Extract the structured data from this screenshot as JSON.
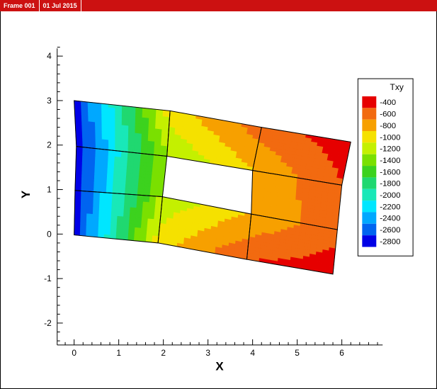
{
  "frame_bar": {
    "frame_label": "Frame 001",
    "date_label": "01 Jul 2015"
  },
  "chart_data": {
    "type": "contour",
    "xlabel": "X",
    "ylabel": "Y",
    "xlim": [
      -0.4,
      6.9
    ],
    "ylim": [
      -2.5,
      4.3
    ],
    "xticks": [
      0,
      1,
      2,
      3,
      4,
      5,
      6
    ],
    "yticks": [
      -2,
      -1,
      0,
      1,
      2,
      3,
      4
    ],
    "legend": {
      "title": "Txy",
      "position": "right",
      "levels": [
        {
          "label": "-400",
          "color": "#e60000"
        },
        {
          "label": "-600",
          "color": "#f26a10"
        },
        {
          "label": "-800",
          "color": "#f7a000"
        },
        {
          "label": "-1000",
          "color": "#f5e100"
        },
        {
          "label": "-1200",
          "color": "#c4f000"
        },
        {
          "label": "-1400",
          "color": "#7ae000"
        },
        {
          "label": "-1600",
          "color": "#3cd21e"
        },
        {
          "label": "-1800",
          "color": "#20d870"
        },
        {
          "label": "-2000",
          "color": "#19e8b8"
        },
        {
          "label": "-2200",
          "color": "#00e6ff"
        },
        {
          "label": "-2400",
          "color": "#00a8ff"
        },
        {
          "label": "-2600",
          "color": "#0064f0"
        },
        {
          "label": "-2800",
          "color": "#0000e6"
        }
      ]
    },
    "mesh": {
      "nodes": [
        [
          0.0,
          3.0
        ],
        [
          2.15,
          2.77
        ],
        [
          4.2,
          2.4
        ],
        [
          6.2,
          2.07
        ],
        [
          0.05,
          1.97
        ],
        [
          2.08,
          1.75
        ],
        [
          4.0,
          1.43
        ],
        [
          6.0,
          1.1
        ],
        [
          0.02,
          0.98
        ],
        [
          1.98,
          0.84
        ],
        [
          3.97,
          0.45
        ],
        [
          5.9,
          0.1
        ],
        [
          0.0,
          -0.02
        ],
        [
          1.88,
          -0.2
        ],
        [
          3.87,
          -0.57
        ],
        [
          5.8,
          -0.9
        ]
      ],
      "elements": [
        [
          0,
          1,
          5,
          4
        ],
        [
          1,
          2,
          6,
          5
        ],
        [
          2,
          3,
          7,
          6
        ],
        [
          4,
          5,
          9,
          8
        ],
        [
          6,
          7,
          11,
          10
        ],
        [
          8,
          9,
          13,
          12
        ],
        [
          9,
          10,
          14,
          13
        ],
        [
          10,
          11,
          15,
          14
        ]
      ],
      "node_values": [
        -2800,
        -1000,
        -600,
        -400,
        -2800,
        -1300,
        -900,
        -500,
        -2800,
        -1250,
        -900,
        -550,
        -2800,
        -1000,
        -500,
        -400
      ]
    }
  }
}
